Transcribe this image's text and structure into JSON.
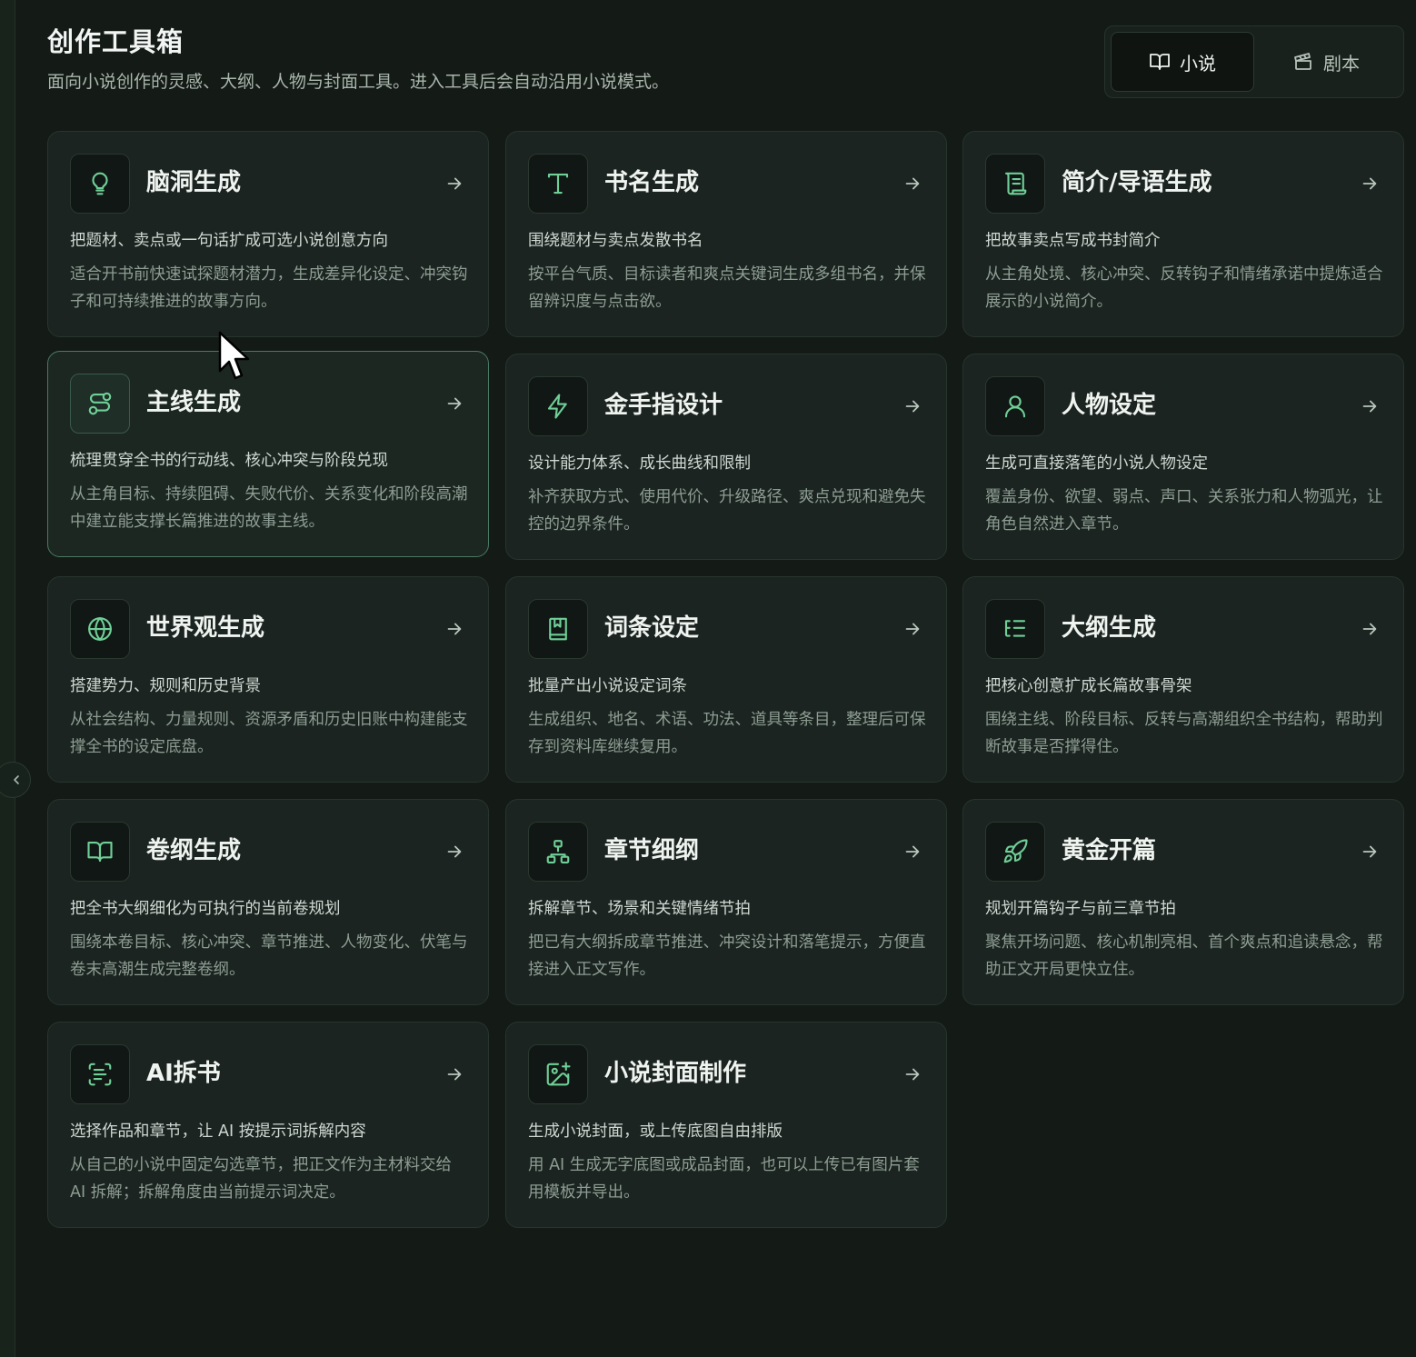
{
  "header": {
    "title": "创作工具箱",
    "subtitle": "面向小说创作的灵感、大纲、人物与封面工具。进入工具后会自动沿用小说模式。"
  },
  "mode_switch": {
    "novel_label": "小说",
    "script_label": "剧本",
    "active": "novel"
  },
  "accent_color": "#6fcf97",
  "tools": [
    {
      "title": "脑洞生成",
      "icon": "lightbulb-icon",
      "summary": "把题材、卖点或一句话扩成可选小说创意方向",
      "desc": "适合开书前快速试探题材潜力，生成差异化设定、冲突钩子和可持续推进的故事方向。"
    },
    {
      "title": "书名生成",
      "icon": "type-icon",
      "summary": "围绕题材与卖点发散书名",
      "desc": "按平台气质、目标读者和爽点关键词生成多组书名，并保留辨识度与点击欲。"
    },
    {
      "title": "简介/导语生成",
      "icon": "scroll-icon",
      "summary": "把故事卖点写成书封简介",
      "desc": "从主角处境、核心冲突、反转钩子和情绪承诺中提炼适合展示的小说简介。"
    },
    {
      "title": "主线生成",
      "icon": "route-icon",
      "summary": "梳理贯穿全书的行动线、核心冲突与阶段兑现",
      "desc": "从主角目标、持续阻碍、失败代价、关系变化和阶段高潮中建立能支撑长篇推进的故事主线。"
    },
    {
      "title": "金手指设计",
      "icon": "lightning-icon",
      "summary": "设计能力体系、成长曲线和限制",
      "desc": "补齐获取方式、使用代价、升级路径、爽点兑现和避免失控的边界条件。"
    },
    {
      "title": "人物设定",
      "icon": "user-icon",
      "summary": "生成可直接落笔的小说人物设定",
      "desc": "覆盖身份、欲望、弱点、声口、关系张力和人物弧光，让角色自然进入章节。"
    },
    {
      "title": "世界观生成",
      "icon": "globe-icon",
      "summary": "搭建势力、规则和历史背景",
      "desc": "从社会结构、力量规则、资源矛盾和历史旧账中构建能支撑全书的设定底盘。"
    },
    {
      "title": "词条设定",
      "icon": "bookmark-book-icon",
      "summary": "批量产出小说设定词条",
      "desc": "生成组织、地名、术语、功法、道具等条目，整理后可保存到资料库继续复用。"
    },
    {
      "title": "大纲生成",
      "icon": "list-tree-icon",
      "summary": "把核心创意扩成长篇故事骨架",
      "desc": "围绕主线、阶段目标、反转与高潮组织全书结构，帮助判断故事是否撑得住。"
    },
    {
      "title": "卷纲生成",
      "icon": "open-book-icon",
      "summary": "把全书大纲细化为可执行的当前卷规划",
      "desc": "围绕本卷目标、核心冲突、章节推进、人物变化、伏笔与卷末高潮生成完整卷纲。"
    },
    {
      "title": "章节细纲",
      "icon": "hierarchy-icon",
      "summary": "拆解章节、场景和关键情绪节拍",
      "desc": "把已有大纲拆成章节推进、冲突设计和落笔提示，方便直接进入正文写作。"
    },
    {
      "title": "黄金开篇",
      "icon": "rocket-icon",
      "summary": "规划开篇钩子与前三章节拍",
      "desc": "聚焦开场问题、核心机制亮相、首个爽点和追读悬念，帮助正文开局更快立住。"
    },
    {
      "title": "AI拆书",
      "icon": "scan-text-icon",
      "summary": "选择作品和章节，让 AI 按提示词拆解内容",
      "desc": "从自己的小说中固定勾选章节，把正文作为主材料交给 AI 拆解；拆解角度由当前提示词决定。"
    },
    {
      "title": "小说封面制作",
      "icon": "image-plus-icon",
      "summary": "生成小说封面，或上传底图自由排版",
      "desc": "用 AI 生成无字底图或成品封面，也可以上传已有图片套用模板并导出。"
    }
  ]
}
